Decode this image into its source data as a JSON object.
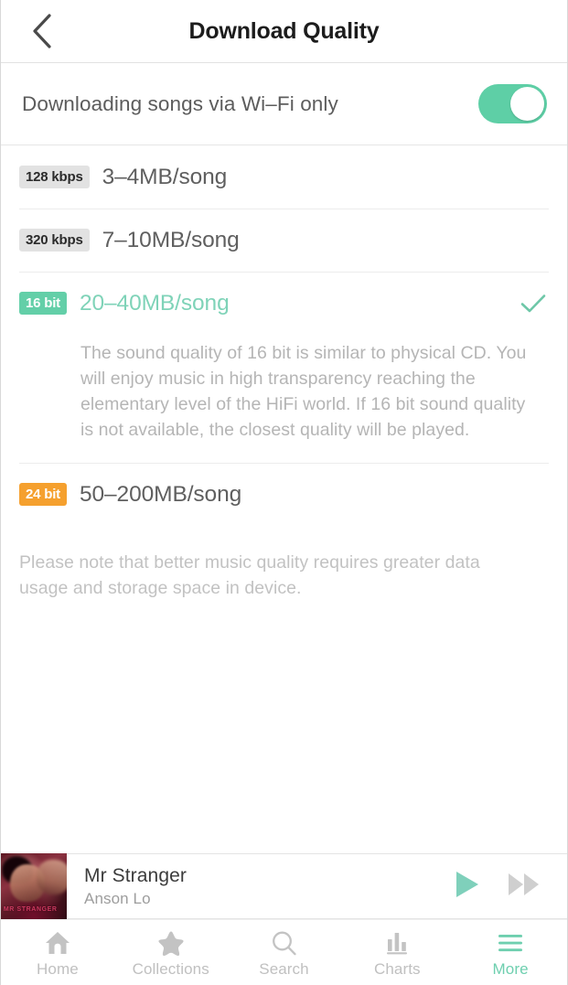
{
  "header": {
    "title": "Download Quality",
    "back_icon": "chevron-left-icon"
  },
  "wifi_setting": {
    "label": "Downloading songs via Wi–Fi only",
    "enabled": true,
    "toggle_on_color": "#5ecfa6"
  },
  "quality_options": [
    {
      "badge": "128 kbps",
      "badge_style": "gray",
      "badge_bg": "#e2e2e2",
      "badge_fg": "#2b2b2b",
      "size_label": "3–4MB/song",
      "selected": false
    },
    {
      "badge": "320 kbps",
      "badge_style": "gray",
      "badge_bg": "#e2e2e2",
      "badge_fg": "#2b2b2b",
      "size_label": "7–10MB/song",
      "selected": false
    },
    {
      "badge": "16 bit",
      "badge_style": "teal",
      "badge_bg": "#63cfa8",
      "badge_fg": "#ffffff",
      "size_label": "20–40MB/song",
      "selected": true,
      "description": "The sound quality of 16 bit is similar to physical CD. You will enjoy music in high transparency reaching the elementary level of the HiFi world. If 16 bit sound quality is not available, the closest quality will be played."
    },
    {
      "badge": "24 bit",
      "badge_style": "orange",
      "badge_bg": "#f5a02e",
      "badge_fg": "#ffffff",
      "size_label": "50–200MB/song",
      "selected": false
    }
  ],
  "footer_note": "Please note that better music quality requires greater data usage and storage space in device.",
  "player": {
    "title": "Mr Stranger",
    "artist": "Anson Lo",
    "artwork_caption": "MR STRANGER",
    "play_icon": "play-icon",
    "next_icon": "fast-forward-icon",
    "play_color": "#7fd0bb",
    "next_color": "#cfcfcf"
  },
  "tabs": [
    {
      "label": "Home",
      "icon": "home-icon",
      "active": false
    },
    {
      "label": "Collections",
      "icon": "star-icon",
      "active": false
    },
    {
      "label": "Search",
      "icon": "search-icon",
      "active": false
    },
    {
      "label": "Charts",
      "icon": "bar-chart-icon",
      "active": false
    },
    {
      "label": "More",
      "icon": "hamburger-icon",
      "active": true
    }
  ],
  "theme": {
    "accent": "#6ecfaf",
    "selected_text": "#7fd3b8",
    "muted_text": "#b5b5b5"
  }
}
